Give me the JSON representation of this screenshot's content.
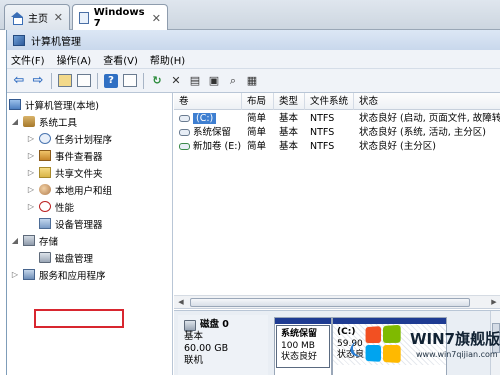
{
  "browser": {
    "tabs": [
      {
        "label": "主页",
        "icon": "home-icon"
      },
      {
        "label": "Windows 7",
        "icon": "page-icon"
      }
    ],
    "close_glyph": "✕"
  },
  "window": {
    "title": "计算机管理",
    "menu": [
      "文件(F)",
      "操作(A)",
      "查看(V)",
      "帮助(H)"
    ]
  },
  "tree": {
    "root": "计算机管理(本地)",
    "system_tools": "系统工具",
    "task_scheduler": "任务计划程序",
    "event_viewer": "事件查看器",
    "shared_folders": "共享文件夹",
    "local_users": "本地用户和组",
    "performance": "性能",
    "device_manager": "设备管理器",
    "storage": "存储",
    "disk_management": "磁盘管理",
    "services": "服务和应用程序"
  },
  "volumes": {
    "columns": [
      "卷",
      "布局",
      "类型",
      "文件系统",
      "状态"
    ],
    "rows": [
      {
        "vol": "(C:)",
        "layout": "简单",
        "type": "基本",
        "fs": "NTFS",
        "status": "状态良好 (启动, 页面文件, 故障转"
      },
      {
        "vol": "系统保留",
        "layout": "简单",
        "type": "基本",
        "fs": "NTFS",
        "status": "状态良好 (系统, 活动, 主分区)"
      },
      {
        "vol": "新加卷 (E:)",
        "layout": "简单",
        "type": "基本",
        "fs": "NTFS",
        "status": "状态良好 (主分区)"
      }
    ]
  },
  "disk": {
    "name": "磁盘 0",
    "type": "基本",
    "size": "60.00 GB",
    "state": "联机",
    "partitions": [
      {
        "name": "系统保留",
        "size": "100 MB",
        "status": "状态良好"
      },
      {
        "name": "(C:)",
        "size": "59.90",
        "status": "状态良"
      }
    ]
  },
  "watermark": {
    "brand": "WIN7旗舰版",
    "url": "www.win7qijian.com"
  }
}
